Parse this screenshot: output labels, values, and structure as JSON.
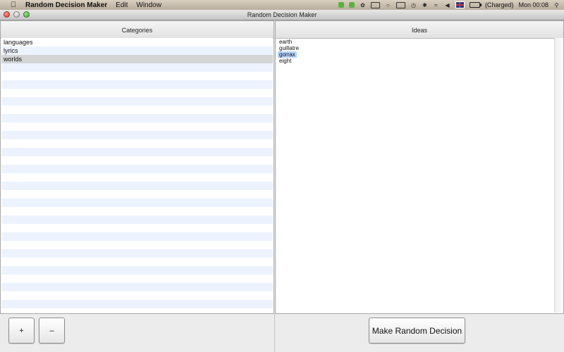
{
  "menubar": {
    "app_name": "Random Decision Maker",
    "menus": [
      "Edit",
      "Window"
    ],
    "battery_status": "(Charged)",
    "clock": "Mon 00:08"
  },
  "window": {
    "title": "Random Decision Maker"
  },
  "categories": {
    "header": "Categories",
    "items": [
      {
        "label": "languages",
        "selected": false
      },
      {
        "label": "lyrics",
        "selected": false
      },
      {
        "label": "worlds",
        "selected": true
      }
    ]
  },
  "ideas": {
    "header": "Ideas",
    "items": [
      {
        "label": "earth",
        "highlighted": false
      },
      {
        "label": "guillatre",
        "highlighted": false
      },
      {
        "label": "gorrax",
        "highlighted": true
      },
      {
        "label": "eight",
        "highlighted": false
      }
    ]
  },
  "buttons": {
    "add_label": "+",
    "remove_label": "–",
    "decide_label": "Make Random Decision"
  },
  "icons": [
    "apple-icon",
    "wifi-icon",
    "volume-icon",
    "flag-icon",
    "battery-icon",
    "spotlight-icon"
  ],
  "colors": {
    "row_stripe": "#edf3fe",
    "selected_row": "#d4d4d4",
    "text_highlight": "#b5d5ff"
  }
}
